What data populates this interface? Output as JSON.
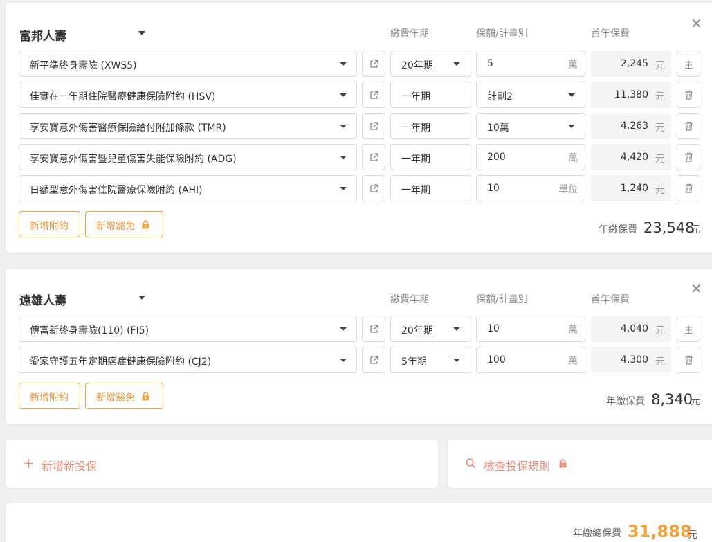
{
  "headers": {
    "term": "繳費年期",
    "amount": "保額/計畫別",
    "premium": "首年保費"
  },
  "currency": "元",
  "colors": {
    "accent": "#f0a33c",
    "link": "#e8907a"
  },
  "companies": [
    {
      "name": "富邦人壽",
      "rows": [
        {
          "plan": "新平準終身壽險 (XWS5)",
          "term": "20年期",
          "amount": "5",
          "unit": "萬",
          "premium": "2,245",
          "action": "主"
        },
        {
          "plan": "佳實在一年期住院醫療健康保險附約 (HSV)",
          "term": "一年期",
          "amount": "計劃2",
          "unit": "",
          "premium": "11,380",
          "action": "trash-icon"
        },
        {
          "plan": "享安寶意外傷害醫療保險給付附加條款 (TMR)",
          "term": "一年期",
          "amount": "10萬",
          "unit": "",
          "premium": "4,263",
          "action": "trash-icon"
        },
        {
          "plan": "享安寶意外傷害暨兒童傷害失能保險附約 (ADG)",
          "term": "一年期",
          "amount": "200",
          "unit": "萬",
          "premium": "4,420",
          "action": "trash-icon"
        },
        {
          "plan": "日額型意外傷害住院醫療保險附約 (AHI)",
          "term": "一年期",
          "amount": "10",
          "unit": "單位",
          "premium": "1,240",
          "action": "trash-icon"
        }
      ],
      "add_rider": "新增附約",
      "add_waiver": "新增豁免",
      "total_label": "年繳保費",
      "total": "23,548"
    },
    {
      "name": "遠雄人壽",
      "rows": [
        {
          "plan": "傳富新終身壽險(110) (FI5)",
          "term": "20年期",
          "amount": "10",
          "unit": "萬",
          "premium": "4,040",
          "action": "主"
        },
        {
          "plan": "愛家守護五年定期癌症健康保險附約 (CJ2)",
          "term": "5年期",
          "amount": "100",
          "unit": "萬",
          "premium": "4,300",
          "action": "trash-icon"
        }
      ],
      "add_rider": "新增附約",
      "add_waiver": "新增豁免",
      "total_label": "年繳保費",
      "total": "8,340"
    }
  ],
  "add_new": "新增新投保",
  "check_rules": "檢查投保規則",
  "grand_total_label": "年繳總保費",
  "grand_total": "31,888"
}
